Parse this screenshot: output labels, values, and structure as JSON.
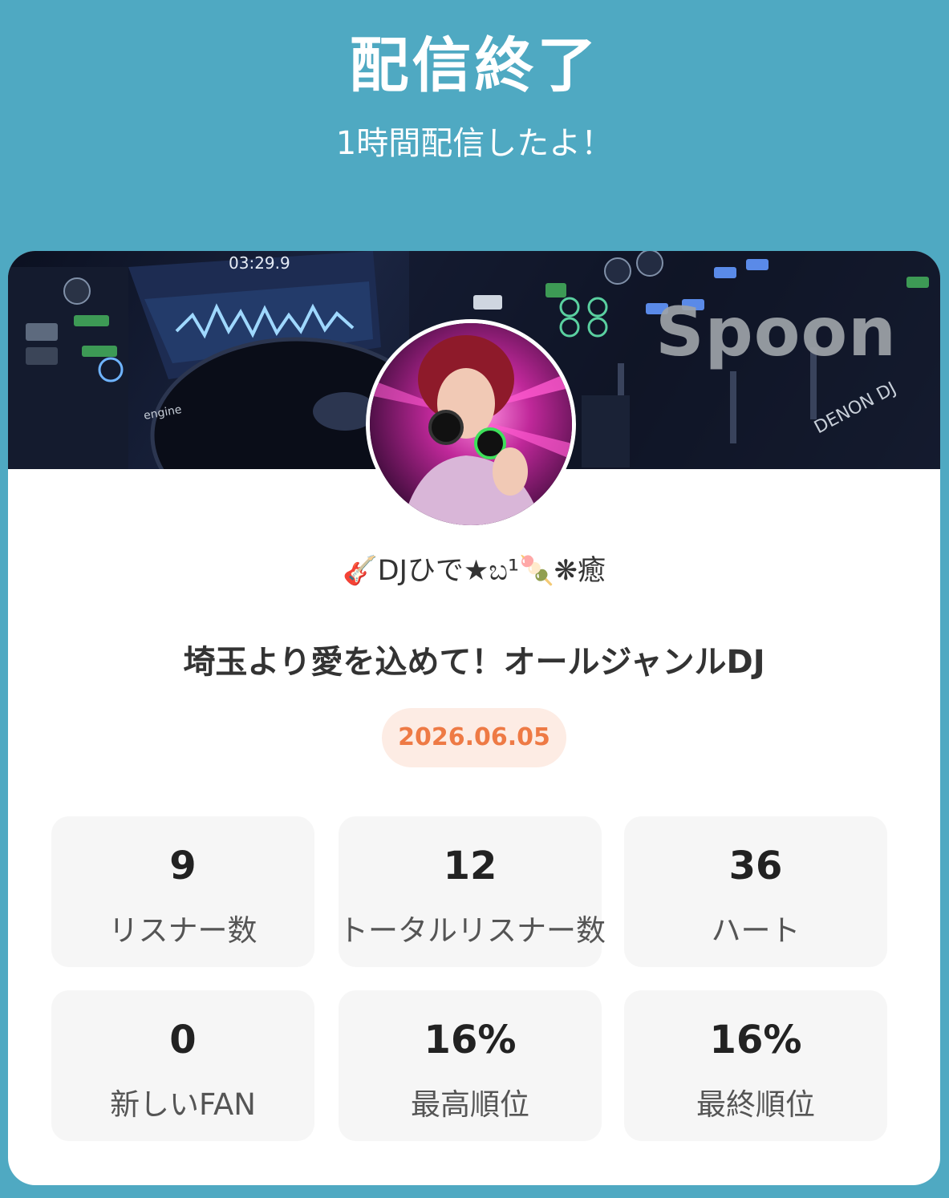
{
  "header": {
    "title": "配信終了",
    "subtitle": "1時間配信したよ！"
  },
  "card": {
    "brand": "Spoon",
    "username": "🎸DJひで★ಬ¹🍡❋癒",
    "broadcast_title": "埼玉より愛を込めて！オールジャンルDJ",
    "date": "2026.06.05"
  },
  "stats": [
    {
      "value": "9",
      "label": "リスナー数"
    },
    {
      "value": "12",
      "label": "トータルリスナー数"
    },
    {
      "value": "36",
      "label": "ハート"
    },
    {
      "value": "0",
      "label": "新しいFAN"
    },
    {
      "value": "16%",
      "label": "最高順位"
    },
    {
      "value": "16%",
      "label": "最終順位"
    }
  ],
  "colors": {
    "background": "#4fa9c2",
    "date_text": "#ee7a45",
    "date_badge": "#fdece4"
  }
}
